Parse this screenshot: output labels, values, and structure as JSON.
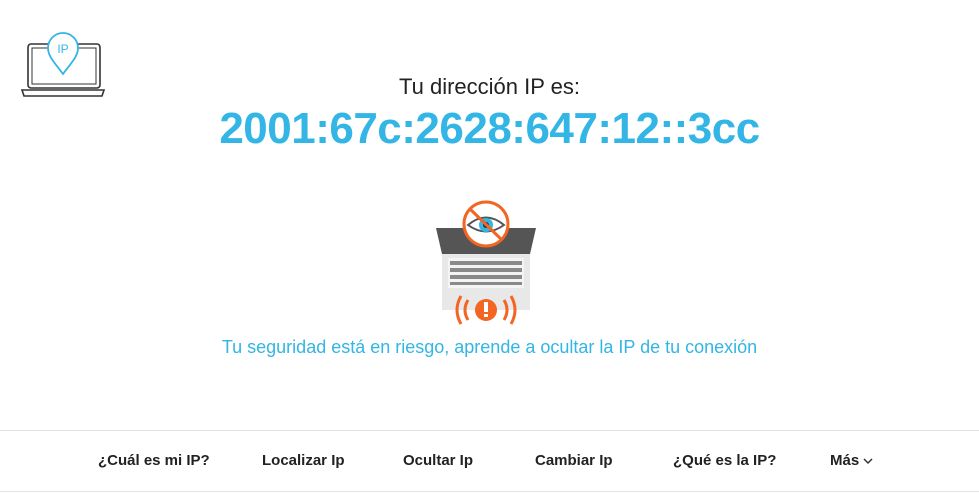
{
  "logo": {
    "badge_text": "IP"
  },
  "main": {
    "heading": "Tu dirección IP es:",
    "ip_address": "2001:67c:2628:647:12::3cc",
    "warning_text": "Tu seguridad está en riesgo, aprende a ocultar la IP de tu conexión"
  },
  "nav": {
    "items": [
      {
        "label": "¿Cuál es mi IP?"
      },
      {
        "label": "Localizar Ip"
      },
      {
        "label": "Ocultar Ip"
      },
      {
        "label": "Cambiar Ip"
      },
      {
        "label": "¿Qué es la IP?"
      },
      {
        "label": "Más",
        "icon": "chevron-down-icon"
      }
    ]
  },
  "colors": {
    "accent": "#33b5e5",
    "alert": "#f26522",
    "text": "#222222",
    "divider": "#e3e3e3"
  }
}
